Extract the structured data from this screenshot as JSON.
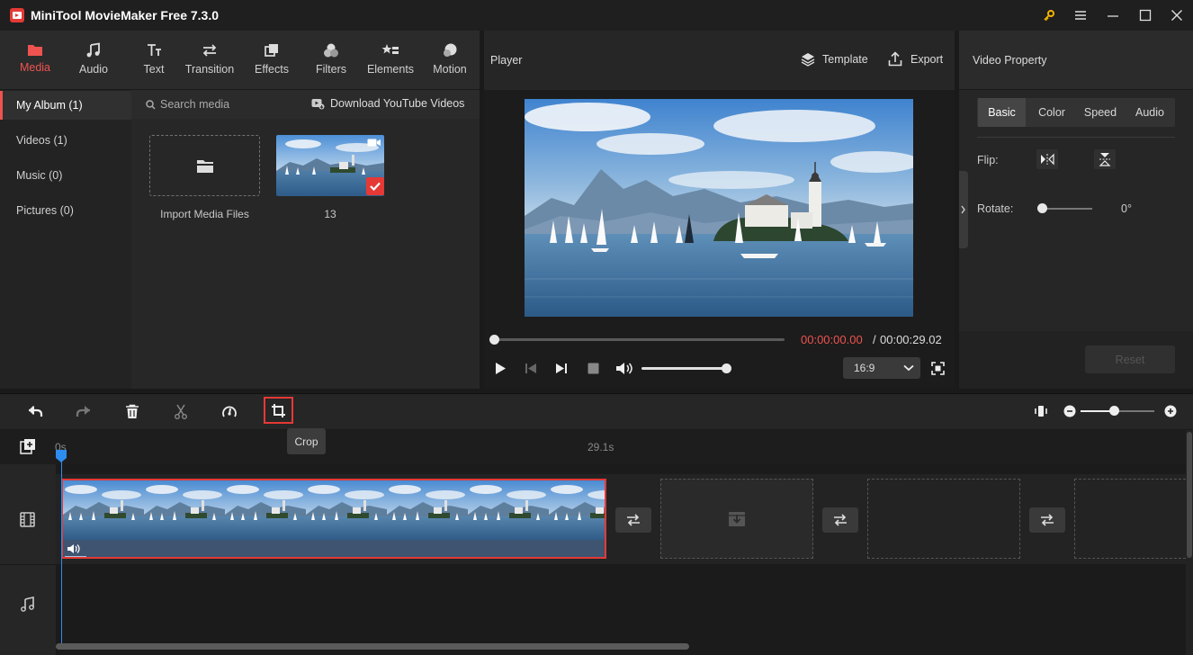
{
  "app": {
    "title": "MiniTool MovieMaker Free 7.3.0"
  },
  "media_tabs": [
    {
      "label": "Media",
      "icon": "folder-icon",
      "active": true
    },
    {
      "label": "Audio",
      "icon": "music-note-icon"
    },
    {
      "label": "Text",
      "icon": "text-icon"
    },
    {
      "label": "Transition",
      "icon": "transition-icon"
    },
    {
      "label": "Effects",
      "icon": "effects-icon"
    },
    {
      "label": "Filters",
      "icon": "filters-icon"
    },
    {
      "label": "Elements",
      "icon": "elements-icon"
    },
    {
      "label": "Motion",
      "icon": "motion-icon"
    }
  ],
  "album": {
    "items": [
      {
        "label": "My Album (1)",
        "active": true
      },
      {
        "label": "Videos (1)"
      },
      {
        "label": "Music (0)"
      },
      {
        "label": "Pictures (0)"
      }
    ]
  },
  "media": {
    "search_placeholder": "Search media",
    "download_label": "Download YouTube Videos",
    "import_label": "Import Media Files",
    "clip_name": "13"
  },
  "player": {
    "title": "Player",
    "template_label": "Template",
    "export_label": "Export",
    "current_time": "00:00:00.00",
    "separator": "/",
    "total_time": "00:00:29.02",
    "aspect_ratio": "16:9",
    "volume_level": 0.95,
    "progress": 0.0
  },
  "property": {
    "title": "Video Property",
    "tabs": [
      "Basic",
      "Color",
      "Speed",
      "Audio"
    ],
    "active_tab": "Basic",
    "flip_label": "Flip:",
    "rotate_label": "Rotate:",
    "rotate_value": "0°",
    "reset_label": "Reset"
  },
  "timeline": {
    "tooltip": "Crop",
    "ruler_start": "0s",
    "ruler_end": "29.1s"
  },
  "colors": {
    "accent": "#e53935",
    "playhead": "#2d8cf0",
    "time_current": "#ef5350"
  }
}
